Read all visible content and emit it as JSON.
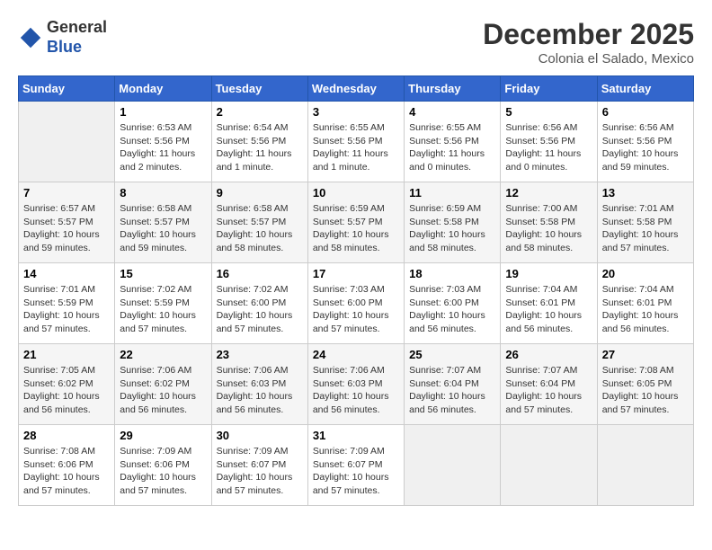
{
  "header": {
    "logo_line1": "General",
    "logo_line2": "Blue",
    "month": "December 2025",
    "location": "Colonia el Salado, Mexico"
  },
  "weekdays": [
    "Sunday",
    "Monday",
    "Tuesday",
    "Wednesday",
    "Thursday",
    "Friday",
    "Saturday"
  ],
  "weeks": [
    [
      {
        "day": "",
        "empty": true
      },
      {
        "day": "1",
        "sunrise": "6:53 AM",
        "sunset": "5:56 PM",
        "daylight": "11 hours and 2 minutes."
      },
      {
        "day": "2",
        "sunrise": "6:54 AM",
        "sunset": "5:56 PM",
        "daylight": "11 hours and 1 minute."
      },
      {
        "day": "3",
        "sunrise": "6:55 AM",
        "sunset": "5:56 PM",
        "daylight": "11 hours and 1 minute."
      },
      {
        "day": "4",
        "sunrise": "6:55 AM",
        "sunset": "5:56 PM",
        "daylight": "11 hours and 0 minutes."
      },
      {
        "day": "5",
        "sunrise": "6:56 AM",
        "sunset": "5:56 PM",
        "daylight": "11 hours and 0 minutes."
      },
      {
        "day": "6",
        "sunrise": "6:56 AM",
        "sunset": "5:56 PM",
        "daylight": "10 hours and 59 minutes."
      }
    ],
    [
      {
        "day": "7",
        "sunrise": "6:57 AM",
        "sunset": "5:57 PM",
        "daylight": "10 hours and 59 minutes."
      },
      {
        "day": "8",
        "sunrise": "6:58 AM",
        "sunset": "5:57 PM",
        "daylight": "10 hours and 59 minutes."
      },
      {
        "day": "9",
        "sunrise": "6:58 AM",
        "sunset": "5:57 PM",
        "daylight": "10 hours and 58 minutes."
      },
      {
        "day": "10",
        "sunrise": "6:59 AM",
        "sunset": "5:57 PM",
        "daylight": "10 hours and 58 minutes."
      },
      {
        "day": "11",
        "sunrise": "6:59 AM",
        "sunset": "5:58 PM",
        "daylight": "10 hours and 58 minutes."
      },
      {
        "day": "12",
        "sunrise": "7:00 AM",
        "sunset": "5:58 PM",
        "daylight": "10 hours and 58 minutes."
      },
      {
        "day": "13",
        "sunrise": "7:01 AM",
        "sunset": "5:58 PM",
        "daylight": "10 hours and 57 minutes."
      }
    ],
    [
      {
        "day": "14",
        "sunrise": "7:01 AM",
        "sunset": "5:59 PM",
        "daylight": "10 hours and 57 minutes."
      },
      {
        "day": "15",
        "sunrise": "7:02 AM",
        "sunset": "5:59 PM",
        "daylight": "10 hours and 57 minutes."
      },
      {
        "day": "16",
        "sunrise": "7:02 AM",
        "sunset": "6:00 PM",
        "daylight": "10 hours and 57 minutes."
      },
      {
        "day": "17",
        "sunrise": "7:03 AM",
        "sunset": "6:00 PM",
        "daylight": "10 hours and 57 minutes."
      },
      {
        "day": "18",
        "sunrise": "7:03 AM",
        "sunset": "6:00 PM",
        "daylight": "10 hours and 56 minutes."
      },
      {
        "day": "19",
        "sunrise": "7:04 AM",
        "sunset": "6:01 PM",
        "daylight": "10 hours and 56 minutes."
      },
      {
        "day": "20",
        "sunrise": "7:04 AM",
        "sunset": "6:01 PM",
        "daylight": "10 hours and 56 minutes."
      }
    ],
    [
      {
        "day": "21",
        "sunrise": "7:05 AM",
        "sunset": "6:02 PM",
        "daylight": "10 hours and 56 minutes."
      },
      {
        "day": "22",
        "sunrise": "7:06 AM",
        "sunset": "6:02 PM",
        "daylight": "10 hours and 56 minutes."
      },
      {
        "day": "23",
        "sunrise": "7:06 AM",
        "sunset": "6:03 PM",
        "daylight": "10 hours and 56 minutes."
      },
      {
        "day": "24",
        "sunrise": "7:06 AM",
        "sunset": "6:03 PM",
        "daylight": "10 hours and 56 minutes."
      },
      {
        "day": "25",
        "sunrise": "7:07 AM",
        "sunset": "6:04 PM",
        "daylight": "10 hours and 56 minutes."
      },
      {
        "day": "26",
        "sunrise": "7:07 AM",
        "sunset": "6:04 PM",
        "daylight": "10 hours and 57 minutes."
      },
      {
        "day": "27",
        "sunrise": "7:08 AM",
        "sunset": "6:05 PM",
        "daylight": "10 hours and 57 minutes."
      }
    ],
    [
      {
        "day": "28",
        "sunrise": "7:08 AM",
        "sunset": "6:06 PM",
        "daylight": "10 hours and 57 minutes."
      },
      {
        "day": "29",
        "sunrise": "7:09 AM",
        "sunset": "6:06 PM",
        "daylight": "10 hours and 57 minutes."
      },
      {
        "day": "30",
        "sunrise": "7:09 AM",
        "sunset": "6:07 PM",
        "daylight": "10 hours and 57 minutes."
      },
      {
        "day": "31",
        "sunrise": "7:09 AM",
        "sunset": "6:07 PM",
        "daylight": "10 hours and 57 minutes."
      },
      {
        "day": "",
        "empty": true
      },
      {
        "day": "",
        "empty": true
      },
      {
        "day": "",
        "empty": true
      }
    ]
  ],
  "labels": {
    "sunrise_prefix": "Sunrise: ",
    "sunset_prefix": "Sunset: ",
    "daylight_prefix": "Daylight: "
  }
}
